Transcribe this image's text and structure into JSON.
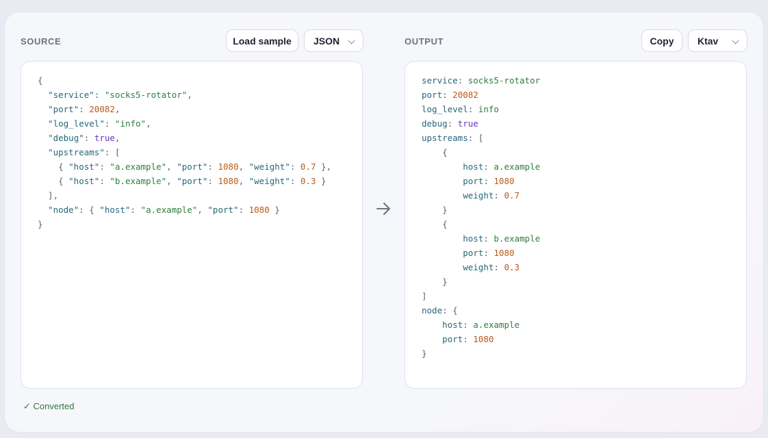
{
  "source": {
    "label": "SOURCE",
    "load_sample_label": "Load sample",
    "format": {
      "value": "JSON"
    }
  },
  "output": {
    "label": "OUTPUT",
    "copy_label": "Copy",
    "format": {
      "value": "Ktav"
    }
  },
  "status": {
    "text": "✓ Converted"
  },
  "colors": {
    "key": "#25667a",
    "string": "#2e7d3f",
    "number": "#b85a18",
    "boolean": "#6f2fc4",
    "punctuation": "#5a6070",
    "status": "#2d7a3c"
  },
  "icons": {
    "convert": "arrow-right-icon",
    "dropdown": "chevron-down-icon"
  },
  "source_code": [
    [
      [
        "p",
        "{"
      ]
    ],
    [
      [
        "p",
        "  "
      ],
      [
        "k",
        "\"service\""
      ],
      [
        "p",
        ": "
      ],
      [
        "s",
        "\"socks5-rotator\""
      ],
      [
        "p",
        ","
      ]
    ],
    [
      [
        "p",
        "  "
      ],
      [
        "k",
        "\"port\""
      ],
      [
        "p",
        ": "
      ],
      [
        "n",
        "20082"
      ],
      [
        "p",
        ","
      ]
    ],
    [
      [
        "p",
        "  "
      ],
      [
        "k",
        "\"log_level\""
      ],
      [
        "p",
        ": "
      ],
      [
        "s",
        "\"info\""
      ],
      [
        "p",
        ","
      ]
    ],
    [
      [
        "p",
        "  "
      ],
      [
        "k",
        "\"debug\""
      ],
      [
        "p",
        ": "
      ],
      [
        "b",
        "true"
      ],
      [
        "p",
        ","
      ]
    ],
    [
      [
        "p",
        "  "
      ],
      [
        "k",
        "\"upstreams\""
      ],
      [
        "p",
        ": ["
      ]
    ],
    [
      [
        "p",
        "    { "
      ],
      [
        "k",
        "\"host\""
      ],
      [
        "p",
        ": "
      ],
      [
        "s",
        "\"a.example\""
      ],
      [
        "p",
        ", "
      ],
      [
        "k",
        "\"port\""
      ],
      [
        "p",
        ": "
      ],
      [
        "n",
        "1080"
      ],
      [
        "p",
        ", "
      ],
      [
        "k",
        "\"weight\""
      ],
      [
        "p",
        ": "
      ],
      [
        "n",
        "0.7"
      ],
      [
        "p",
        " },"
      ]
    ],
    [
      [
        "p",
        "    { "
      ],
      [
        "k",
        "\"host\""
      ],
      [
        "p",
        ": "
      ],
      [
        "s",
        "\"b.example\""
      ],
      [
        "p",
        ", "
      ],
      [
        "k",
        "\"port\""
      ],
      [
        "p",
        ": "
      ],
      [
        "n",
        "1080"
      ],
      [
        "p",
        ", "
      ],
      [
        "k",
        "\"weight\""
      ],
      [
        "p",
        ": "
      ],
      [
        "n",
        "0.3"
      ],
      [
        "p",
        " }"
      ]
    ],
    [
      [
        "p",
        "  ],"
      ]
    ],
    [
      [
        "p",
        "  "
      ],
      [
        "k",
        "\"node\""
      ],
      [
        "p",
        ": { "
      ],
      [
        "k",
        "\"host\""
      ],
      [
        "p",
        ": "
      ],
      [
        "s",
        "\"a.example\""
      ],
      [
        "p",
        ", "
      ],
      [
        "k",
        "\"port\""
      ],
      [
        "p",
        ": "
      ],
      [
        "n",
        "1080"
      ],
      [
        "p",
        " }"
      ]
    ],
    [
      [
        "p",
        "}"
      ]
    ]
  ],
  "output_code": [
    [
      [
        "k",
        "service"
      ],
      [
        "p",
        ": "
      ],
      [
        "s",
        "socks5-rotator"
      ]
    ],
    [
      [
        "k",
        "port"
      ],
      [
        "p",
        ": "
      ],
      [
        "n",
        "20082"
      ]
    ],
    [
      [
        "k",
        "log_level"
      ],
      [
        "p",
        ": "
      ],
      [
        "s",
        "info"
      ]
    ],
    [
      [
        "k",
        "debug"
      ],
      [
        "p",
        ": "
      ],
      [
        "b",
        "true"
      ]
    ],
    [
      [
        "k",
        "upstreams"
      ],
      [
        "p",
        ": ["
      ]
    ],
    [
      [
        "p",
        "    {"
      ]
    ],
    [
      [
        "p",
        "        "
      ],
      [
        "k",
        "host"
      ],
      [
        "p",
        ": "
      ],
      [
        "s",
        "a.example"
      ]
    ],
    [
      [
        "p",
        "        "
      ],
      [
        "k",
        "port"
      ],
      [
        "p",
        ": "
      ],
      [
        "n",
        "1080"
      ]
    ],
    [
      [
        "p",
        "        "
      ],
      [
        "k",
        "weight"
      ],
      [
        "p",
        ": "
      ],
      [
        "n",
        "0.7"
      ]
    ],
    [
      [
        "p",
        "    }"
      ]
    ],
    [
      [
        "p",
        "    {"
      ]
    ],
    [
      [
        "p",
        "        "
      ],
      [
        "k",
        "host"
      ],
      [
        "p",
        ": "
      ],
      [
        "s",
        "b.example"
      ]
    ],
    [
      [
        "p",
        "        "
      ],
      [
        "k",
        "port"
      ],
      [
        "p",
        ": "
      ],
      [
        "n",
        "1080"
      ]
    ],
    [
      [
        "p",
        "        "
      ],
      [
        "k",
        "weight"
      ],
      [
        "p",
        ": "
      ],
      [
        "n",
        "0.3"
      ]
    ],
    [
      [
        "p",
        "    }"
      ]
    ],
    [
      [
        "p",
        "]"
      ]
    ],
    [
      [
        "k",
        "node"
      ],
      [
        "p",
        ": {"
      ]
    ],
    [
      [
        "p",
        "    "
      ],
      [
        "k",
        "host"
      ],
      [
        "p",
        ": "
      ],
      [
        "s",
        "a.example"
      ]
    ],
    [
      [
        "p",
        "    "
      ],
      [
        "k",
        "port"
      ],
      [
        "p",
        ": "
      ],
      [
        "n",
        "1080"
      ]
    ],
    [
      [
        "p",
        "}"
      ]
    ]
  ]
}
